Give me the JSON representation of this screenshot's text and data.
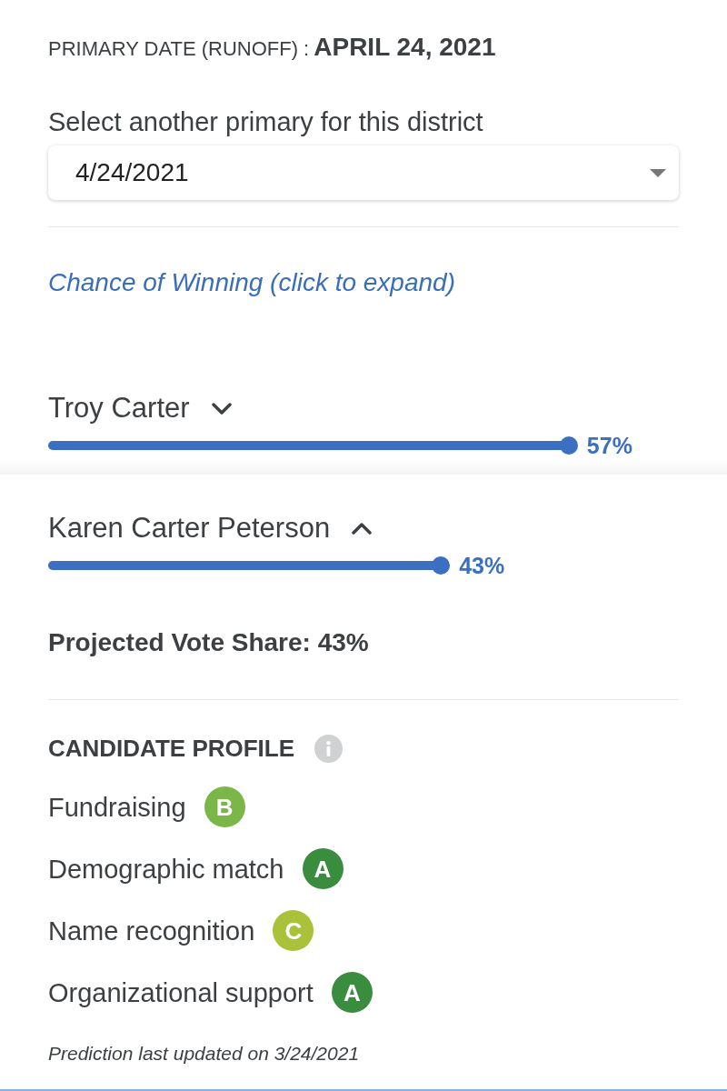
{
  "primary_date": {
    "label": "PRIMARY DATE (RUNOFF) :",
    "value": "APRIL 24, 2021"
  },
  "primary_select": {
    "label": "Select another primary for this district",
    "value": "4/24/2021"
  },
  "chance_link": "Chance of Winning (click to expand)",
  "candidates": [
    {
      "name": "Troy Carter",
      "expanded": false,
      "level": 0.57,
      "reading": "57%"
    },
    {
      "name": "Karen Carter Peterson",
      "expanded": true,
      "level": 0.43,
      "reading": "43%",
      "details": {
        "projected_vote_share": "Projected Vote Share: 43%",
        "profile_title": "CANDIDATE PROFILE",
        "profile": [
          {
            "label": "Fundraising",
            "grade": "B",
            "color": "#7ab648"
          },
          {
            "label": "Demographic match",
            "grade": "A",
            "color": "#3a8c3f"
          },
          {
            "label": "Name recognition",
            "grade": "C",
            "color": "#a9c23a"
          },
          {
            "label": "Organizational support",
            "grade": "A",
            "color": "#3a8c3f"
          }
        ],
        "updated": "Prediction last updated on 3/24/2021"
      }
    }
  ]
}
